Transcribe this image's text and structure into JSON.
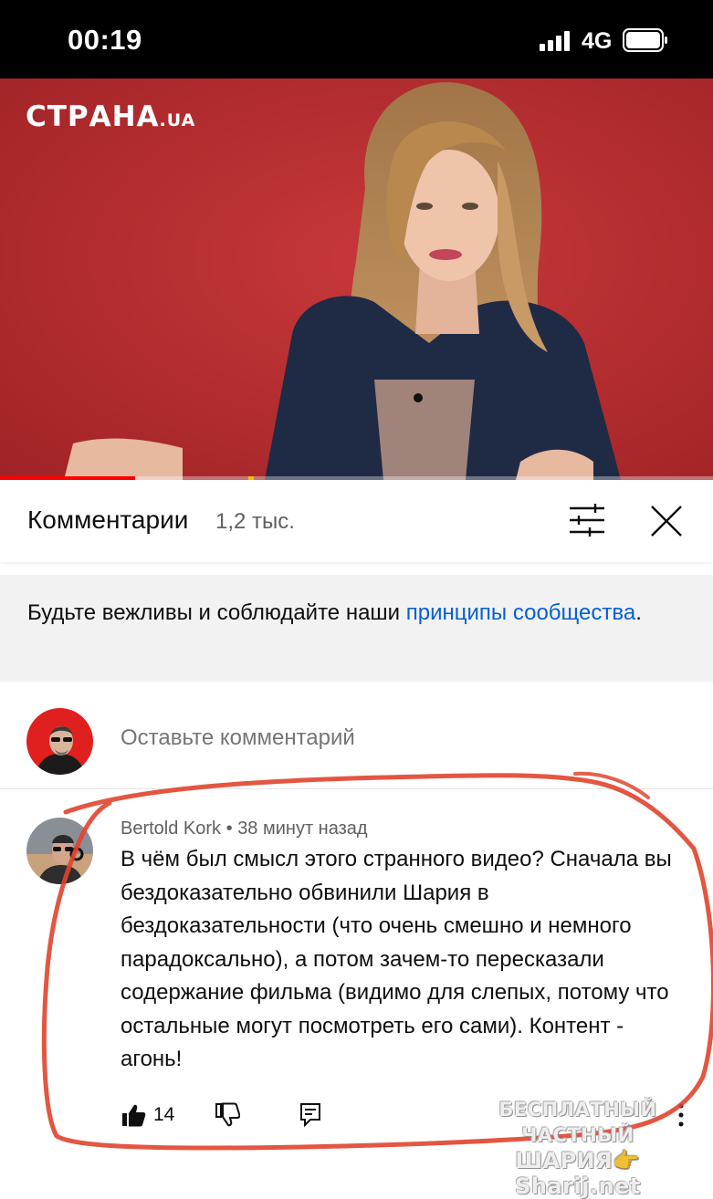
{
  "status_bar": {
    "time": "00:19",
    "network": "4G"
  },
  "video": {
    "channel_logo": "СТРАНА",
    "channel_logo_tld": ".UA",
    "progress_fraction": 0.19,
    "background_color": "#b52a2a"
  },
  "comments_header": {
    "title": "Комментарии",
    "count": "1,2 тыс.",
    "filter_icon": "sliders-icon",
    "close_icon": "close-icon"
  },
  "guidelines": {
    "text_before": "Будьте вежливы и соблюдайте наши ",
    "link_text": "принципы сообщества",
    "text_after": "."
  },
  "add_comment": {
    "placeholder": "Оставьте комментарий"
  },
  "comment": {
    "author": "Bertold Kork",
    "separator": " • ",
    "time": "38 минут назад",
    "text": "В чём был смысл этого странного видео? Сначала вы бездоказательно обвинили Шария в бездоказательности (что очень смешно и немного парадоксально), а потом зачем-то пересказали содержание фильма (видимо для слепых, потому что остальные могут посмотреть его сами). Контент - агонь!",
    "likes": "14"
  },
  "watermark": {
    "line1": "БЕСПЛАТНЫЙ ЧАСТНЫЙ",
    "line2": "ШАРИЯ👉 Sharij.net"
  },
  "colors": {
    "accent_link": "#065fd4",
    "progress": "#ff0000",
    "highlight": "#e0442c"
  }
}
